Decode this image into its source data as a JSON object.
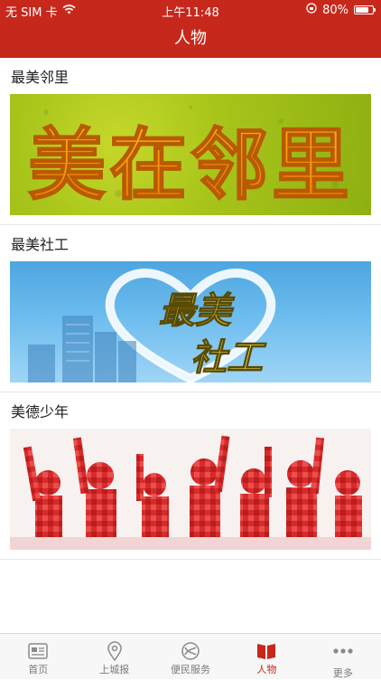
{
  "status_bar": {
    "carrier": "无 SIM 卡",
    "time": "上午11:48",
    "battery": "80%"
  },
  "header": {
    "title": "人物"
  },
  "sections": [
    {
      "title": "最美邻里",
      "banner_text": "美在邻里"
    },
    {
      "title": "最美社工",
      "banner_text_line1": "最美",
      "banner_text_line2": "社工"
    },
    {
      "title": "美德少年"
    }
  ],
  "tabs": [
    {
      "label": "首页",
      "icon": "newspaper-icon"
    },
    {
      "label": "上城报",
      "icon": "location-pin-icon"
    },
    {
      "label": "便民服务",
      "icon": "service-icon"
    },
    {
      "label": "人物",
      "icon": "book-icon"
    },
    {
      "label": "更多",
      "icon": "more-dots-icon"
    }
  ],
  "colors": {
    "brand": "#c7281c",
    "tab_inactive": "#7a7a7a"
  }
}
